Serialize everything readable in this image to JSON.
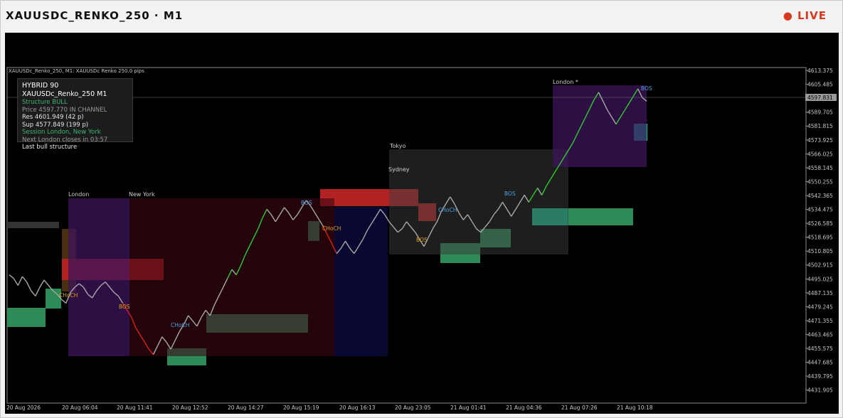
{
  "header": {
    "title": "XAUUSDC_RENKO_250 · M1",
    "live": "● LIVE"
  },
  "chart_window_label": "XAUUSDc_Renko_250, M1:  XAUUSDc Renko 250.0 pips",
  "hud": {
    "title": "HYBRID 90  XAUUSDc_Renko_250 M1",
    "structure": "Structure  BULL",
    "price": "Price  4597.770   IN CHANNEL",
    "res": "Res  4601.949  (42 p)",
    "sup": "Sup  4577.849  (199 p)",
    "session": "Session  London, New York",
    "next": "Next  London closes in 03:57",
    "last": "Last  bull structure"
  },
  "sessions": [
    "London",
    "New York",
    "Tokyo",
    "Sydney",
    "London *"
  ],
  "markers": {
    "bos": "BOS",
    "choch": "CHoCH"
  },
  "colors": {
    "bull": "#2ecc2e",
    "bear": "#e01a1a",
    "neutral": "#a8a8a8",
    "support": "#2e8b57",
    "resistance": "#b22222",
    "marker": "#4fa3e0",
    "signal": "#e0a21a"
  },
  "chart_data": {
    "type": "line",
    "title": "",
    "y_ticks": [
      "4613.375",
      "4605.485",
      "4597.831",
      "4589.705",
      "4581.815",
      "4573.925",
      "4566.025",
      "4558.145",
      "4550.255",
      "4542.365",
      "4534.475",
      "4526.585",
      "4518.695",
      "4510.805",
      "4502.915",
      "4495.025",
      "4487.135",
      "4479.245",
      "4471.355",
      "4463.465",
      "4455.575",
      "4447.685",
      "4439.795",
      "4431.905"
    ],
    "current_price": "4597.831",
    "ylim": [
      4428,
      4617
    ],
    "x_ticks": [
      "20 Aug 2026",
      "20 Aug 06:04",
      "20 Aug 11:41",
      "20 Aug 12:52",
      "20 Aug 14:27",
      "20 Aug 15:19",
      "20 Aug 16:13",
      "20 Aug 23:05",
      "21 Aug 01:41",
      "21 Aug 04:36",
      "21 Aug 07:26",
      "21 Aug 10:18"
    ],
    "series": [
      {
        "values": [
          4500,
          4498,
          4494,
          4499,
          4496,
          4491,
          4488,
          4493,
          4497,
          4494,
          4491,
          4489,
          4486,
          4484,
          4490,
          4493,
          4495,
          4493,
          4489,
          4487,
          4491,
          4494,
          4496,
          4493,
          4490,
          4488,
          4484,
          4480,
          4476,
          4470,
          4466,
          4462,
          4458,
          4455,
          4460,
          4465,
          4462,
          4458,
          4463,
          4468,
          4472,
          4477,
          4474,
          4471,
          4476,
          4480,
          4477,
          4483,
          4488,
          4493,
          4498,
          4503,
          4500,
          4505,
          4511,
          4516,
          4521,
          4526,
          4532,
          4537,
          4534,
          4530,
          4534,
          4538,
          4535,
          4531,
          4534,
          4538,
          4542,
          4539,
          4535,
          4531,
          4527,
          4522,
          4517,
          4512,
          4515,
          4519,
          4515,
          4512,
          4516,
          4520,
          4525,
          4529,
          4533,
          4537,
          4534,
          4530,
          4527,
          4524,
          4526,
          4530,
          4527,
          4524,
          4520,
          4516,
          4521,
          4526,
          4530,
          4536,
          4540,
          4544,
          4540,
          4535,
          4531,
          4534,
          4530,
          4526,
          4524,
          4527,
          4530,
          4534,
          4537,
          4541,
          4537,
          4533,
          4537,
          4541,
          4545,
          4541,
          4545,
          4549,
          4545,
          4550,
          4554,
          4558,
          4562,
          4566,
          4570,
          4574,
          4579,
          4584,
          4589,
          4594,
          4599,
          4603,
          4598,
          4593,
          4589,
          4585,
          4589,
          4593,
          4597,
          4601,
          4605,
          4600,
          4598
        ]
      }
    ]
  }
}
